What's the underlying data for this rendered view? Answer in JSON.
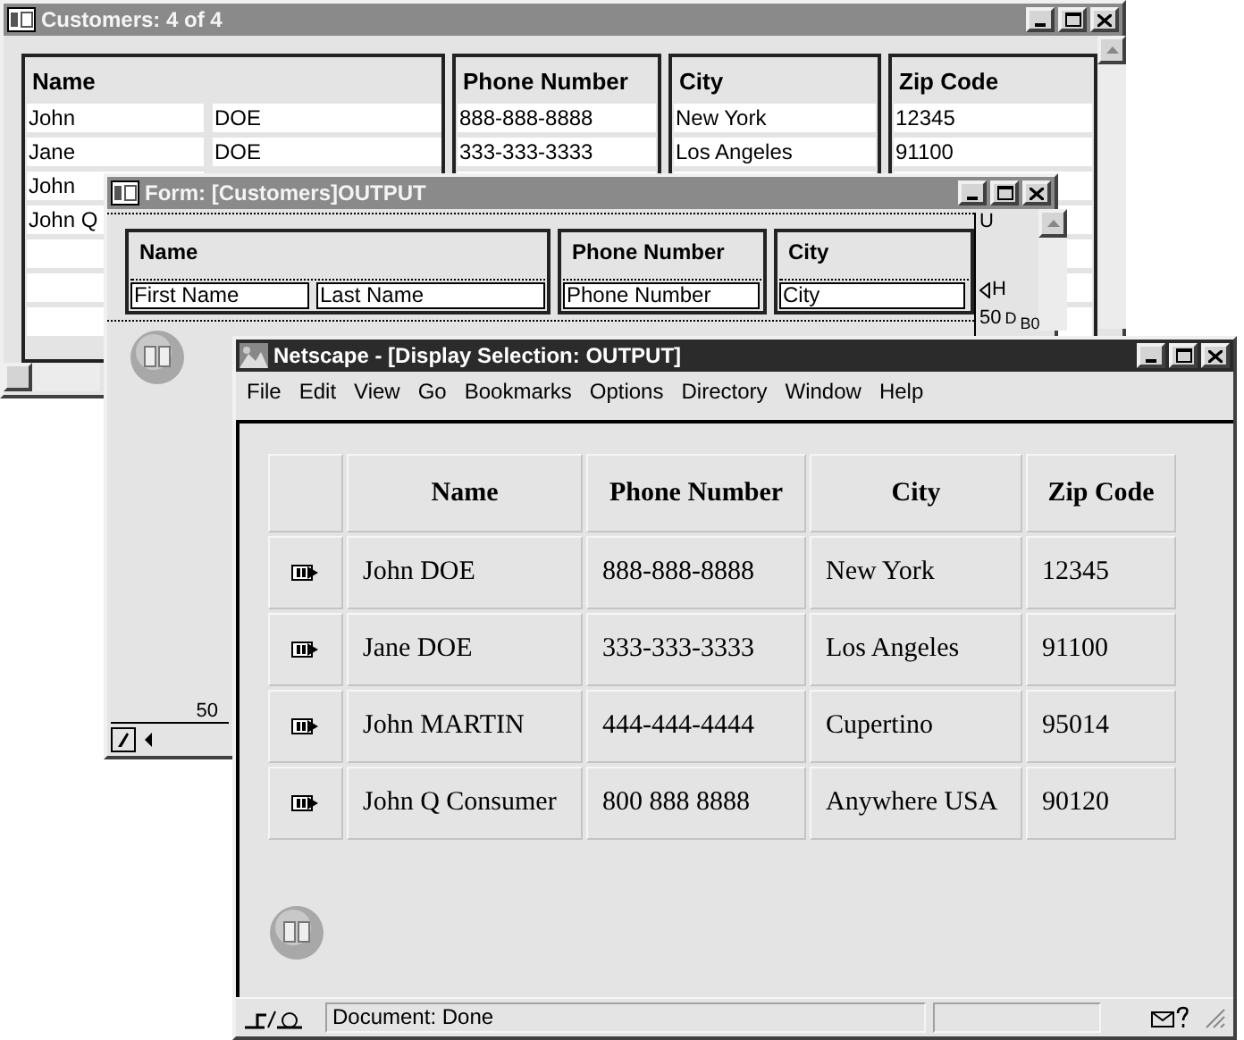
{
  "customers_window": {
    "title": "Customers: 4 of 4",
    "active": false,
    "columns": [
      "Name",
      "Phone Number",
      "City",
      "Zip Code"
    ],
    "rows": [
      {
        "first_name": "John",
        "last_name": "DOE",
        "phone": "888-888-8888",
        "city": "New York",
        "zip": "12345"
      },
      {
        "first_name": "Jane",
        "last_name": "DOE",
        "phone": "333-333-3333",
        "city": "Los Angeles",
        "zip": "91100"
      },
      {
        "first_name": "John"
      },
      {
        "first_name": "John Q"
      }
    ]
  },
  "form_window": {
    "title": "Form: [Customers]OUTPUT",
    "active": false,
    "groups": [
      {
        "label": "Name",
        "fields": [
          "First Name",
          "Last Name"
        ]
      },
      {
        "label": "Phone Number",
        "fields": [
          "Phone Number"
        ]
      },
      {
        "label": "City",
        "fields": [
          "City"
        ]
      }
    ],
    "ruler_labels": [
      "U",
      "H",
      "50",
      "D",
      "B0"
    ],
    "bottom_ruler_label": "50"
  },
  "browser_window": {
    "title": "Netscape - [Display Selection: OUTPUT]",
    "active": true,
    "menu": [
      "File",
      "Edit",
      "View",
      "Go",
      "Bookmarks",
      "Options",
      "Directory",
      "Window",
      "Help"
    ],
    "table": {
      "columns": [
        "Name",
        "Phone Number",
        "City",
        "Zip Code"
      ],
      "rows": [
        [
          "John DOE",
          "888-888-8888",
          "New York",
          "12345"
        ],
        [
          "Jane DOE",
          "333-333-3333",
          "Los Angeles",
          "91100"
        ],
        [
          "John MARTIN",
          "444-444-4444",
          "Cupertino",
          "95014"
        ],
        [
          "John Q Consumer",
          "800 888 8888",
          "Anywhere USA",
          "90120"
        ]
      ]
    },
    "status": "Document: Done"
  }
}
